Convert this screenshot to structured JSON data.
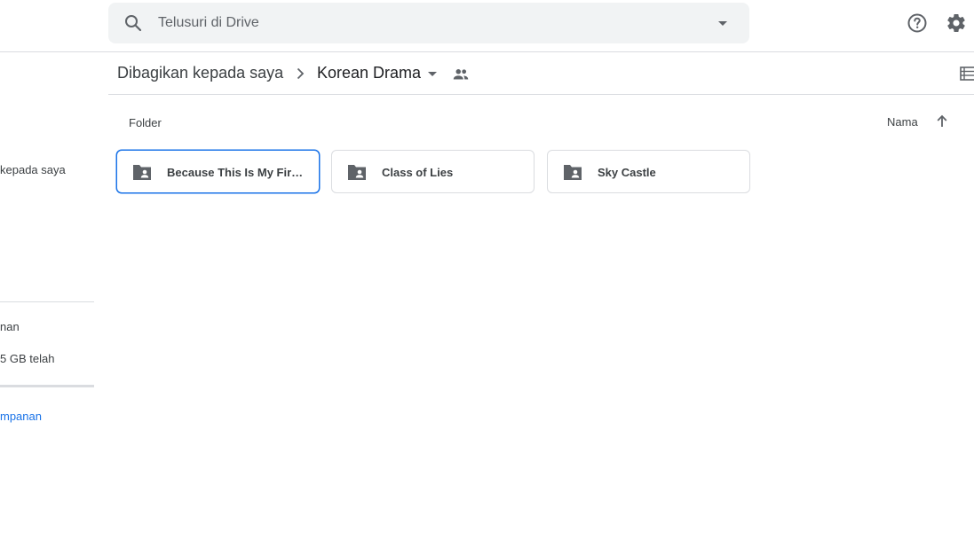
{
  "search": {
    "placeholder": "Telusuri di Drive"
  },
  "sidebar": {
    "shared_label": "kepada saya",
    "storage_heading": "nan",
    "storage_usage": "5 GB telah",
    "storage_link": "mpanan"
  },
  "breadcrumb": {
    "parent": "Dibagikan kepada saya",
    "current": "Korean Drama"
  },
  "content": {
    "section_label": "Folder",
    "sort_label": "Nama",
    "folders": [
      {
        "name": "Because This Is My First Life"
      },
      {
        "name": "Class of Lies"
      },
      {
        "name": "Sky Castle"
      }
    ]
  },
  "colors": {
    "accent": "#1a73e8",
    "icon": "#5f6368",
    "border": "#dadce0"
  }
}
